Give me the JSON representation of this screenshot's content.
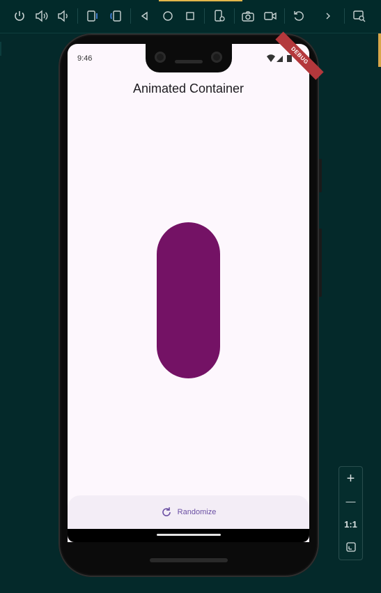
{
  "toolbar": {
    "items": [
      {
        "name": "power-icon"
      },
      {
        "name": "volume-up-icon"
      },
      {
        "name": "volume-down-icon"
      },
      {
        "name": "rotate-left-icon"
      },
      {
        "name": "rotate-right-icon"
      },
      {
        "name": "back-icon"
      },
      {
        "name": "home-icon"
      },
      {
        "name": "overview-icon"
      },
      {
        "name": "device-settings-icon"
      },
      {
        "name": "camera-icon"
      },
      {
        "name": "video-icon"
      },
      {
        "name": "reset-icon"
      },
      {
        "name": "chevron-right-icon"
      },
      {
        "name": "snapshot-search-icon"
      }
    ]
  },
  "phone": {
    "status_time": "9:46",
    "debug_banner": "DEBUG",
    "app_title": "Animated Container",
    "container_color": "#741265",
    "button_label": "Randomize"
  },
  "zoom": {
    "zoom_in": "+",
    "zoom_out": "—",
    "actual_size": "1:1"
  },
  "colors": {
    "background": "#04292a",
    "screen": "#fdf7fd",
    "accent": "#6a4fa3"
  }
}
